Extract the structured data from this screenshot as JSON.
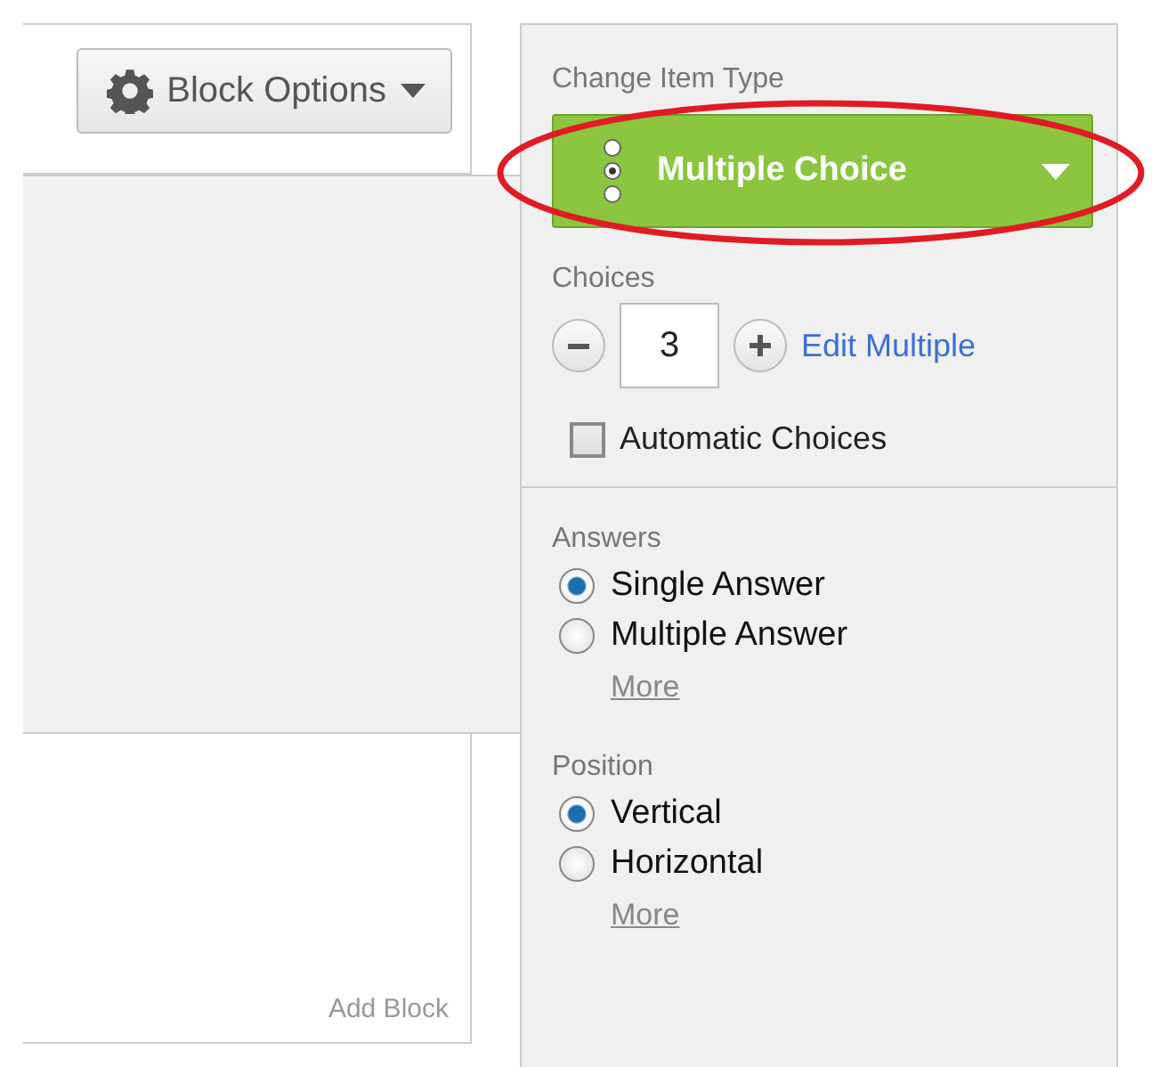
{
  "toolbar": {
    "block_options": "Block Options"
  },
  "canvas": {
    "add_block": "Add Block"
  },
  "panel": {
    "item_type": {
      "label": "Change Item Type",
      "value": "Multiple Choice"
    },
    "choices": {
      "label": "Choices",
      "count": "3",
      "edit_multiple": "Edit Multiple",
      "automatic": {
        "label": "Automatic Choices",
        "checked": false
      }
    },
    "answers": {
      "label": "Answers",
      "options": [
        {
          "label": "Single Answer",
          "selected": true
        },
        {
          "label": "Multiple Answer",
          "selected": false
        }
      ],
      "more": "More"
    },
    "position": {
      "label": "Position",
      "options": [
        {
          "label": "Vertical",
          "selected": true
        },
        {
          "label": "Horizontal",
          "selected": false
        }
      ],
      "more": "More"
    }
  }
}
